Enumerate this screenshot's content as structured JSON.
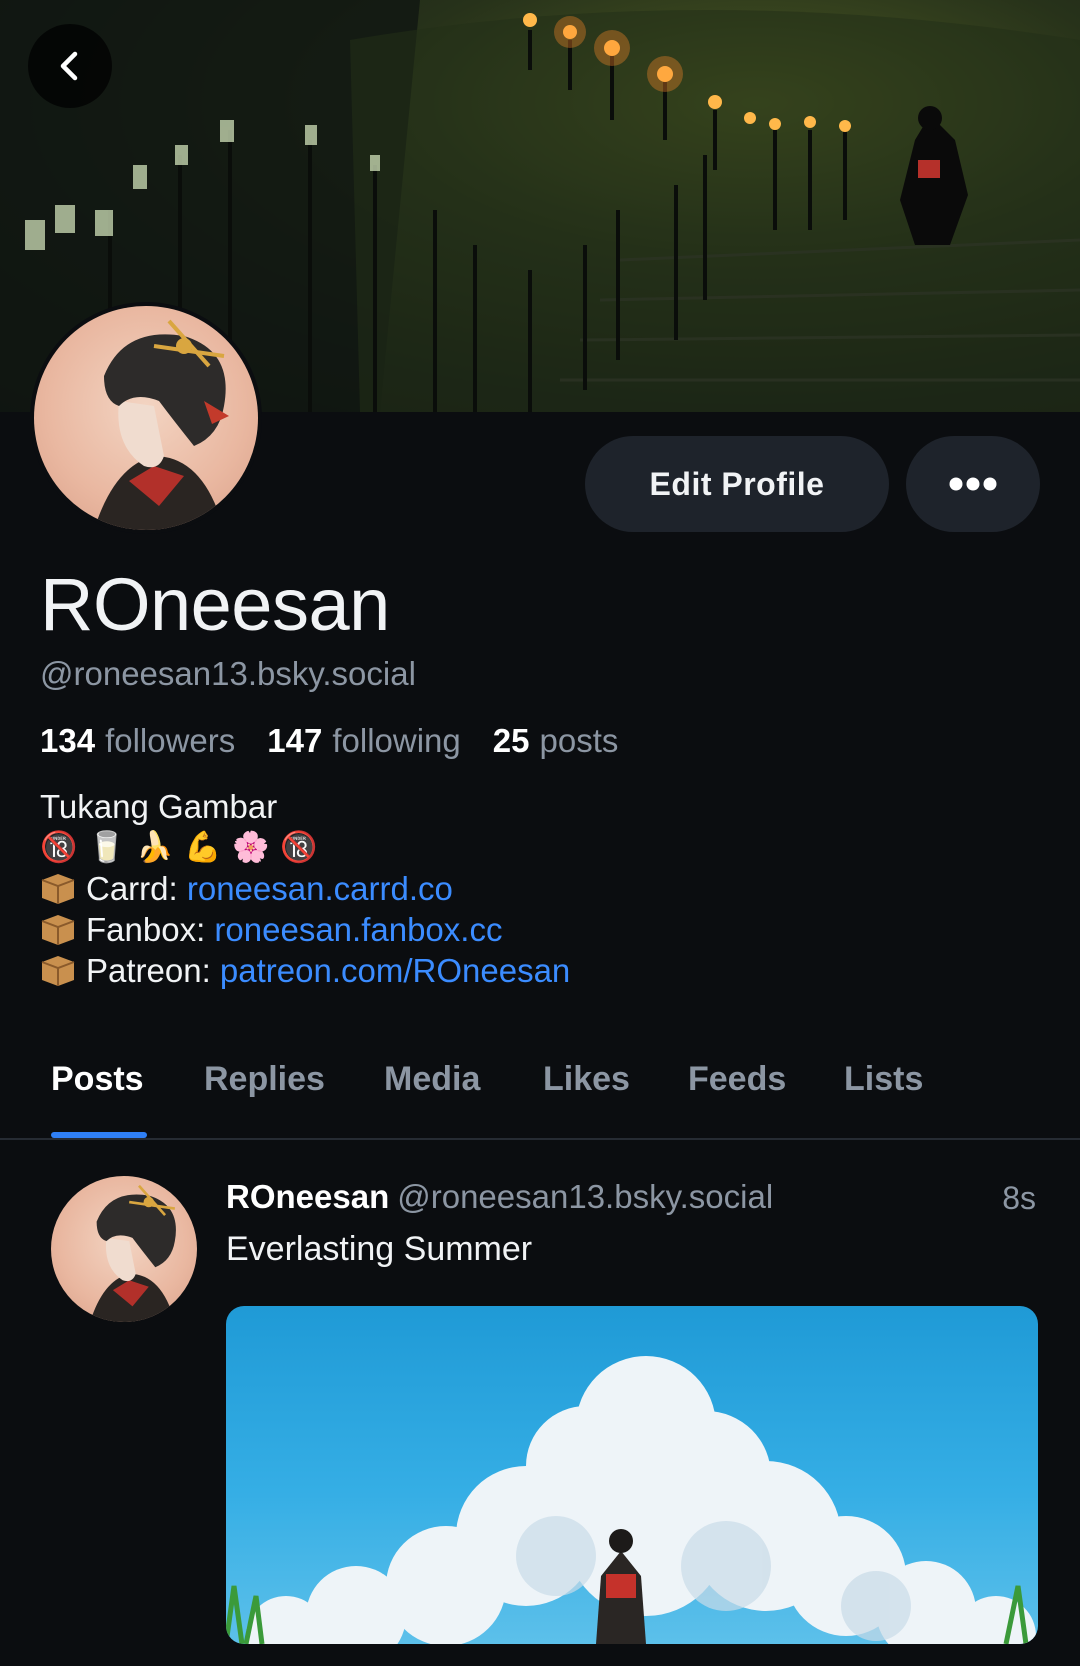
{
  "nav": {
    "back_icon": "chevron-left-icon"
  },
  "profile": {
    "display_name": "ROneesan",
    "handle": "@roneesan13.bsky.social",
    "stats": [
      {
        "value": "134",
        "label": "followers"
      },
      {
        "value": "147",
        "label": "following"
      },
      {
        "value": "25",
        "label": "posts"
      }
    ],
    "bio": {
      "line1": "Tukang Gambar",
      "emojis": [
        "🔞",
        "🥛",
        "🍌",
        "💪",
        "🌸",
        "🔞"
      ],
      "links": [
        {
          "label": "Carrd: ",
          "url": "roneesan.carrd.co"
        },
        {
          "label": "Fanbox: ",
          "url": "roneesan.fanbox.cc"
        },
        {
          "label": "Patreon: ",
          "url": "patreon.com/ROneesan"
        }
      ]
    }
  },
  "actions": {
    "edit_label": "Edit Profile",
    "more_icon": "ellipsis-icon"
  },
  "tabs": [
    {
      "label": "Posts",
      "active": true
    },
    {
      "label": "Replies",
      "active": false
    },
    {
      "label": "Media",
      "active": false
    },
    {
      "label": "Likes",
      "active": false
    },
    {
      "label": "Feeds",
      "active": false
    },
    {
      "label": "Lists",
      "active": false
    }
  ],
  "post": {
    "author": "ROneesan",
    "handle": "@roneesan13.bsky.social",
    "time": "8s",
    "text": "Everlasting Summer"
  },
  "colors": {
    "background": "#0b0d10",
    "link": "#3b8cff",
    "tab_indicator": "#2f7ff5",
    "muted": "#8c96a3"
  }
}
